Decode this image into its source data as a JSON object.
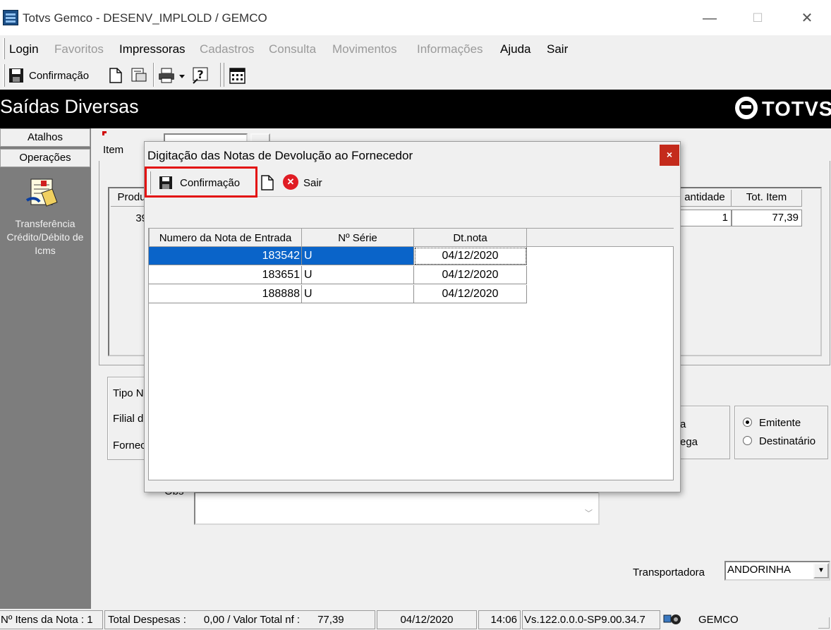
{
  "window": {
    "title": "Totvs Gemco - DESENV_IMPLOLD / GEMCO",
    "minimize": "—",
    "maximize": "☐",
    "close": "✕"
  },
  "menu": [
    {
      "label": "Login",
      "enabled": true
    },
    {
      "label": "Favoritos",
      "enabled": false
    },
    {
      "label": "Impressoras",
      "enabled": true
    },
    {
      "label": "Cadastros",
      "enabled": false
    },
    {
      "label": "Consulta",
      "enabled": false
    },
    {
      "label": "Movimentos",
      "enabled": false
    },
    {
      "label": "Informações",
      "enabled": false
    },
    {
      "label": "Ajuda",
      "enabled": true
    },
    {
      "label": "Sair",
      "enabled": true
    }
  ],
  "toolbar": {
    "confirm_label": "Confirmação"
  },
  "header": {
    "title": "Saídas Diversas",
    "logo": "TOTVS"
  },
  "sidebar": {
    "tabs": [
      "Atalhos",
      "Operações"
    ],
    "shortcut_label": "Transferência Crédito/Débito de Icms"
  },
  "form": {
    "item_label": "Item",
    "items_table": {
      "headers": {
        "produto": "Produ",
        "quantidade": "antidade",
        "tot_item": "Tot. Item"
      },
      "row": {
        "produto": "39",
        "quantidade": "1",
        "tot_item": "77,39"
      }
    },
    "labels": {
      "tipo": "Tipo N",
      "filial": "Filial d",
      "fornecedor": "Fornec",
      "obs": "Obs",
      "group_a": "a",
      "group_b": "ega"
    },
    "radio": {
      "emitente": "Emitente",
      "destinatario": "Destinatário",
      "selected": "Emitente"
    },
    "transportadora_label": "Transportadora",
    "transportadora_value": "ANDORINHA"
  },
  "dialog": {
    "title": "Digitação das Notas de Devolução ao Fornecedor",
    "close_label": "×",
    "confirm_label": "Confirmação",
    "exit_label": "Sair",
    "columns": [
      "Numero da Nota de Entrada",
      "Nº  Série",
      "Dt.nota"
    ],
    "rows": [
      {
        "numero": "183542",
        "serie": "U",
        "data": "04/12/2020",
        "selected": true
      },
      {
        "numero": "183651",
        "serie": "U",
        "data": "04/12/2020",
        "selected": false
      },
      {
        "numero": "188888",
        "serie": "U",
        "data": "04/12/2020",
        "selected": false
      }
    ]
  },
  "status": {
    "itens": "Nº Itens da Nota : 1",
    "despesas": "Total Despesas :      0,00 / Valor Total nf :      77,39",
    "date": "04/12/2020",
    "time": "14:06",
    "version": "Vs.122.0.0.0-SP9.00.34.7",
    "user": "GEMCO"
  },
  "colors": {
    "header_bg": "#000000",
    "sidebar_bg": "#7d7d7d",
    "selection": "#0a64c9",
    "highlight_border": "#e31212",
    "close_red": "#c42b1c"
  }
}
